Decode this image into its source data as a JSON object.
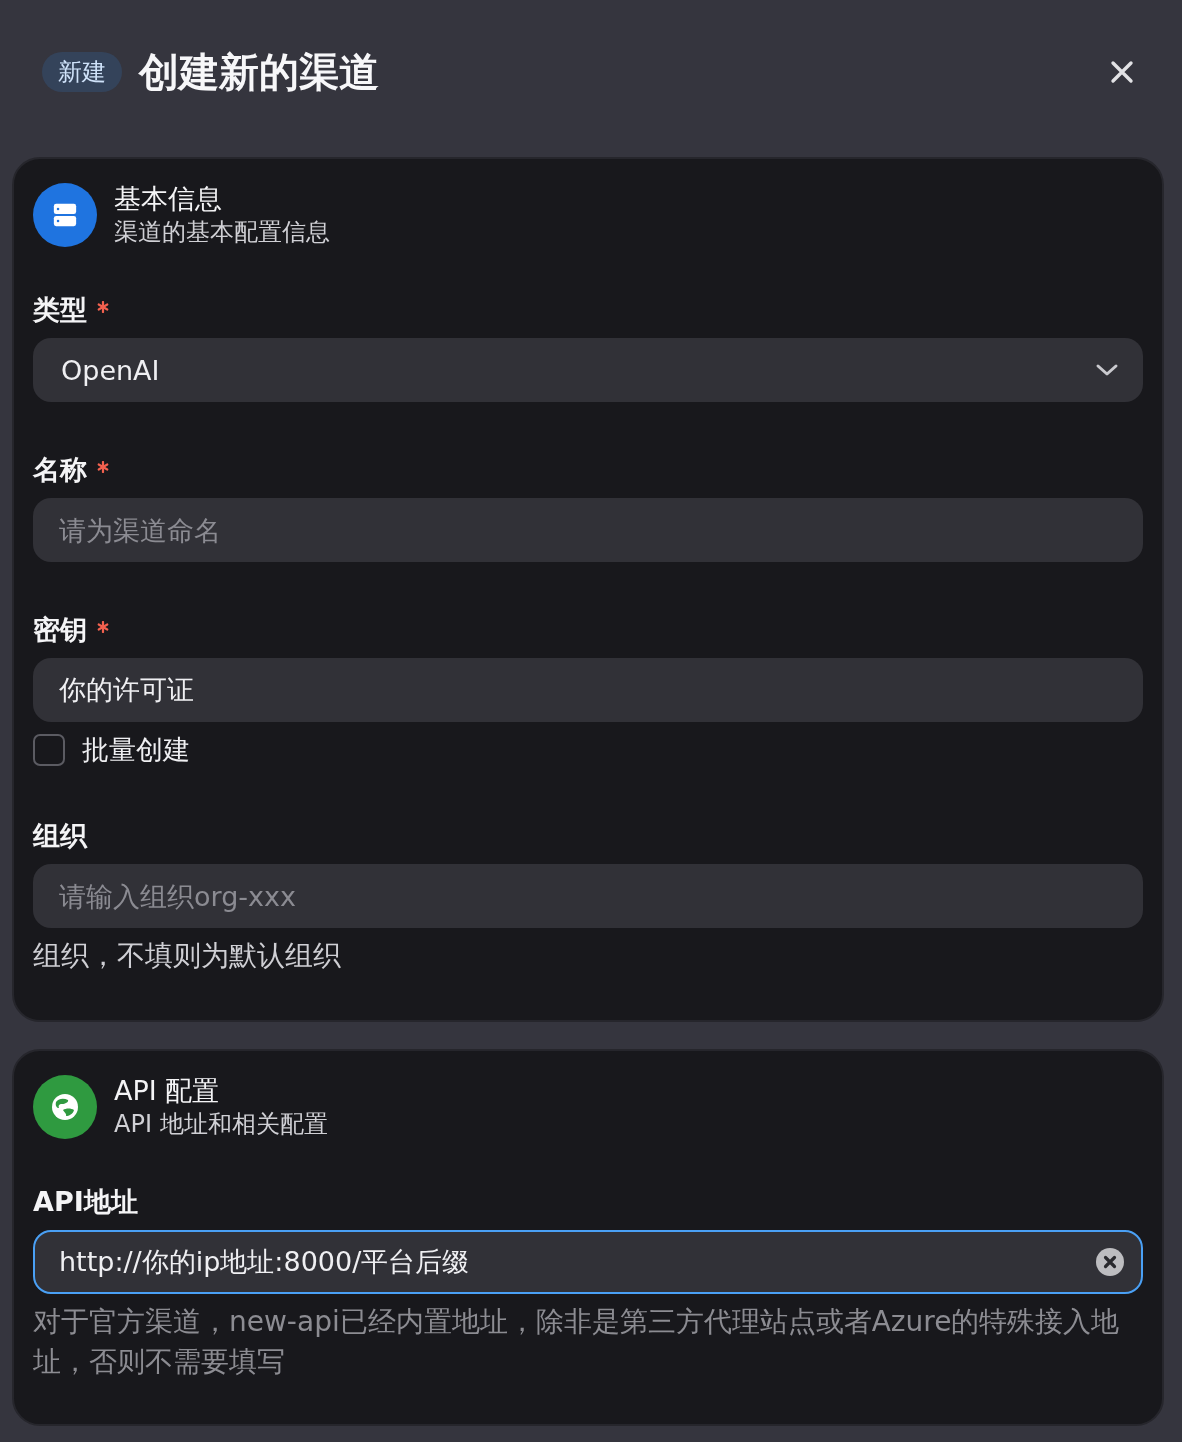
{
  "dialog": {
    "badge": "新建",
    "title": "创建新的渠道"
  },
  "sections": [
    {
      "kind": "basic",
      "color": "#1f74e0",
      "title": "基本信息",
      "subtitle": "渠道的基本配置信息",
      "fields": [
        {
          "kind": "select",
          "label": "类型",
          "required": true,
          "focused": false,
          "value": "OpenAI"
        },
        {
          "kind": "input",
          "label": "名称",
          "required": true,
          "focused": false,
          "clearable": false,
          "placeholder": "请为渠道命名"
        },
        {
          "kind": "input",
          "label": "密钥",
          "required": true,
          "focused": false,
          "clearable": false,
          "value": "你的许可证",
          "checkbox": {
            "label": "批量创建",
            "checked": false
          }
        },
        {
          "kind": "input",
          "label": "组织",
          "focused": false,
          "clearable": false,
          "placeholder": "请输入组织org-xxx",
          "helper": "组织，不填则为默认组织",
          "helper_dim": false
        }
      ]
    },
    {
      "kind": "api",
      "color": "#2f9a40",
      "title": "API 配置",
      "subtitle": "API 地址和相关配置",
      "fields": [
        {
          "kind": "input",
          "label": "API地址",
          "focused": true,
          "clearable": true,
          "value": "http://你的ip地址:8000/平台后缀",
          "helper": "对于官方渠道，new-api已经内置地址，除非是第三方代理站点或者Azure的特殊接入地址，否则不需要填写",
          "helper_dim": true
        }
      ]
    }
  ]
}
